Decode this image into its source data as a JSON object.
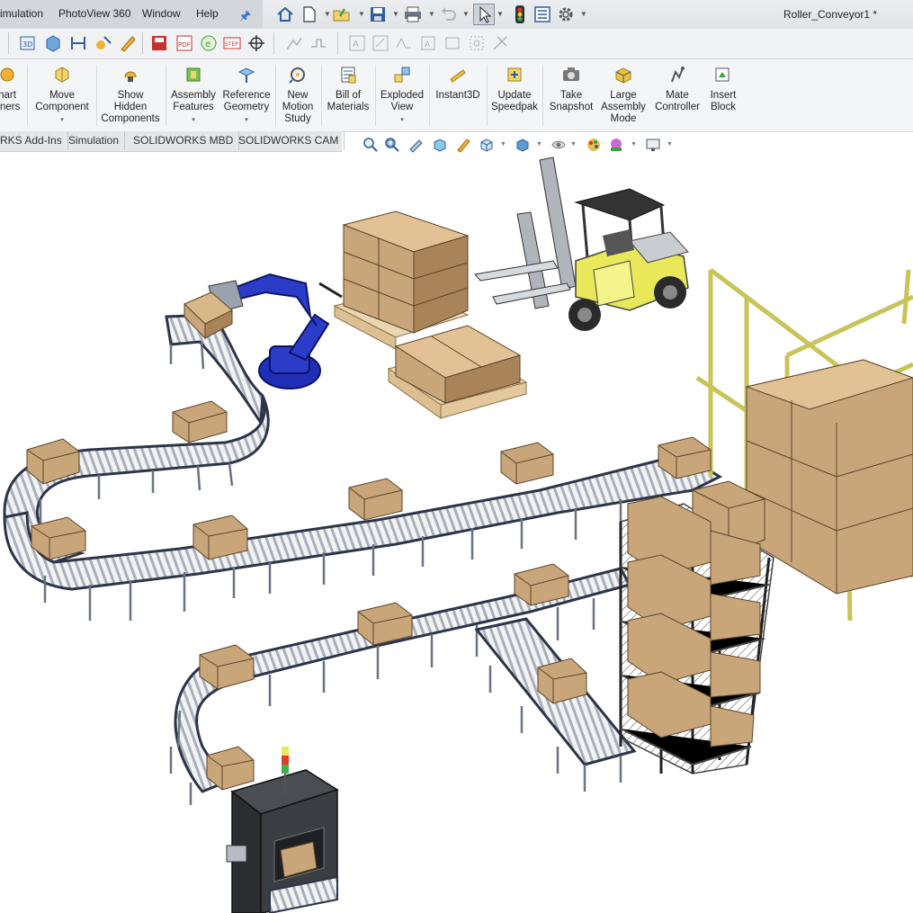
{
  "menu": {
    "items": [
      "imulation",
      "PhotoView 360",
      "Window",
      "Help"
    ]
  },
  "document": {
    "title": "Roller_Conveyor1 *"
  },
  "command_manager": {
    "buttons": [
      {
        "label": "hart\neners",
        "icon": "smart-fasteners-icon"
      },
      {
        "label": "Move\nComponent",
        "icon": "move-component-icon",
        "dropdown": "▾"
      },
      {
        "label": "Show\nHidden\nComponents",
        "icon": "show-hidden-components-icon"
      },
      {
        "label": "Assembly\nFeatures",
        "icon": "assembly-features-icon",
        "dropdown": "▾"
      },
      {
        "label": "Reference\nGeometry",
        "icon": "reference-geometry-icon",
        "dropdown": "▾"
      },
      {
        "label": "New\nMotion\nStudy",
        "icon": "new-motion-study-icon"
      },
      {
        "label": "Bill of\nMaterials",
        "icon": "bill-of-materials-icon"
      },
      {
        "label": "Exploded\nView",
        "icon": "exploded-view-icon",
        "dropdown": "▾"
      },
      {
        "label": "Instant3D",
        "icon": "instant3d-icon"
      },
      {
        "label": "Update\nSpeedpak",
        "icon": "update-speedpak-icon"
      },
      {
        "label": "Take\nSnapshot",
        "icon": "camera-icon"
      },
      {
        "label": "Large\nAssembly\nMode",
        "icon": "large-assembly-mode-icon"
      },
      {
        "label": "Mate\nController",
        "icon": "mate-controller-icon"
      },
      {
        "label": "Insert\nBlock",
        "icon": "insert-block-icon"
      }
    ]
  },
  "tabs": [
    "RKS Add-Ins",
    "Simulation",
    "SOLIDWORKS MBD",
    "SOLIDWORKS CAM"
  ],
  "icons": {
    "home": "home-icon",
    "new": "new-document-icon",
    "open": "open-folder-icon",
    "save": "save-icon",
    "print": "print-icon",
    "undo": "undo-icon",
    "select": "select-arrow-icon",
    "rebuild": "traffic-light-icon",
    "file_props": "file-properties-icon",
    "options": "gear-icon"
  },
  "colors": {
    "accent": "#3a78c4",
    "robot": "#1f2fb8",
    "box": "#c9a57a",
    "box_dark": "#9c7a52",
    "pallet": "#ead6b0",
    "forklift": "#e9e85a",
    "frame": "#c8c45a",
    "conveyor": "#2c3448"
  }
}
